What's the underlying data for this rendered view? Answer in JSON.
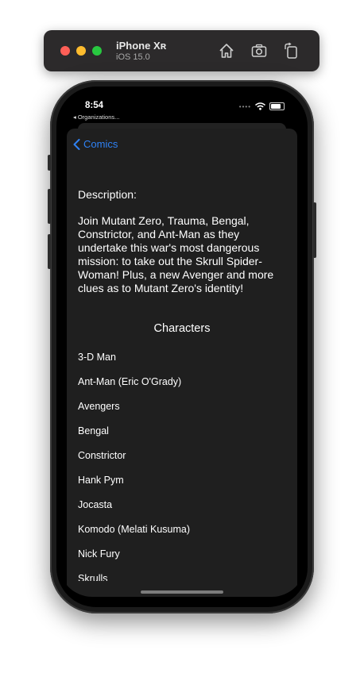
{
  "simulator": {
    "device_name": "iPhone Xʀ",
    "os_version": "iOS 15.0",
    "home_icon": "home-icon",
    "screenshot_icon": "camera-icon",
    "rotate_icon": "rotate-icon"
  },
  "status_bar": {
    "time": "8:54",
    "back_app": "◂ Organizations..."
  },
  "nav": {
    "back_label": "Comics"
  },
  "description": {
    "label": "Description:",
    "text": "Join Mutant Zero, Trauma, Bengal, Constrictor, and Ant-Man as they undertake this war's most dangerous mission: to take out the Skrull Spider-Woman! Plus, a new Avenger and more clues as to Mutant Zero's identity!"
  },
  "characters": {
    "title": "Characters",
    "items": [
      "3-D Man",
      "Ant-Man (Eric O'Grady)",
      "Avengers",
      "Bengal",
      "Constrictor",
      "Hank Pym",
      "Jocasta",
      "Komodo (Melati Kusuma)",
      "Nick Fury",
      "Skrulls"
    ]
  },
  "colors": {
    "accent": "#2f82f5",
    "sheet_background": "#1f1f1f"
  }
}
